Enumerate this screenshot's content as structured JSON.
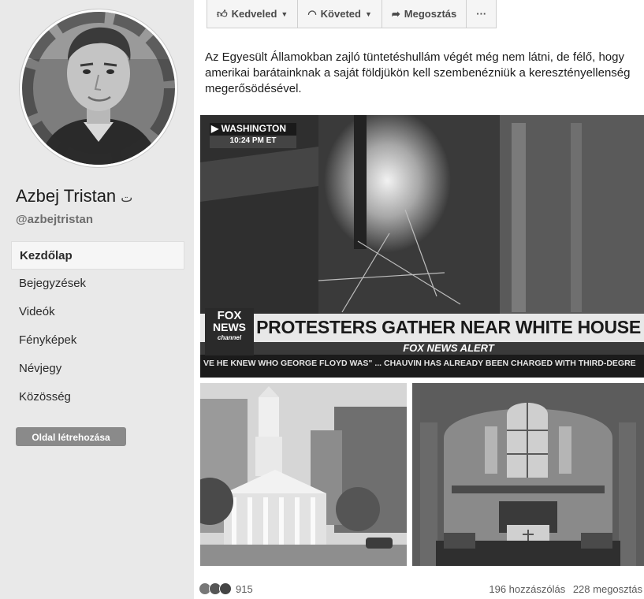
{
  "profile": {
    "name": "Azbej Tristan",
    "handle": "@azbejtristan",
    "avatar_ring_text": "#vigyazzunkegymasra"
  },
  "nav": {
    "items": [
      {
        "label": "Kezdőlap",
        "active": true
      },
      {
        "label": "Bejegyzések"
      },
      {
        "label": "Videók"
      },
      {
        "label": "Fényképek"
      },
      {
        "label": "Névjegy"
      },
      {
        "label": "Közösség"
      }
    ],
    "create_page_label": "Oldal létrehozása"
  },
  "actions": {
    "like_label": "Kedveled",
    "follow_label": "Követed",
    "share_label": "Megosztás",
    "more_label": "···"
  },
  "post": {
    "text": "Az Egyesült Államokban zajló tüntetéshullám végét még nem látni, de félő, hogy amerikai barátainknak a saját földjükön kell szembenézniük a keresztényellenség megerősödésével."
  },
  "video": {
    "location": "WASHINGTON",
    "time": "10:24 PM ET",
    "logo_line1": "FOX",
    "logo_line2": "NEWS",
    "logo_line3": "channel",
    "headline": "PROTESTERS GATHER NEAR WHITE HOUSE",
    "alert": "FOX NEWS ALERT",
    "ticker": "VE HE KNEW WHO GEORGE FLOYD WAS\" ...  CHAUVIN HAS ALREADY BEEN CHARGED WITH THIRD-DEGRE"
  },
  "footer": {
    "reaction_count": "915",
    "comments": "196 hozzászólás",
    "shares": "228 megosztás"
  }
}
